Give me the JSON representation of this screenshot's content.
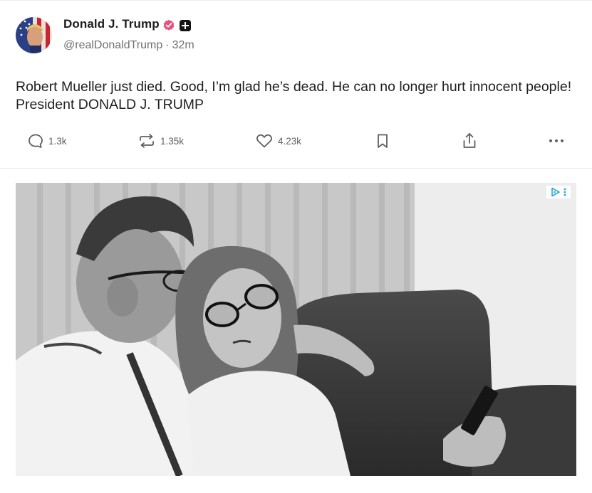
{
  "post": {
    "author_name": "Donald J. Trump",
    "handle": "@realDonaldTrump",
    "separator": "·",
    "time": "32m",
    "text": "Robert Mueller just died. Good, I’m glad he’s dead. He can no longer hurt innocent people! President DONALD J. TRUMP",
    "actions": {
      "replies": "1.3k",
      "reposts": "1.35k",
      "likes": "4.23k"
    },
    "icons": {
      "verified": "verified-badge-icon",
      "plus": "plus-badge-icon",
      "reply": "reply-icon",
      "repost": "repost-icon",
      "like": "heart-icon",
      "bookmark": "bookmark-icon",
      "share": "share-icon",
      "more": "more-icon"
    }
  },
  "ad": {
    "icons": [
      "ad-choices-icon",
      "ad-menu-icon"
    ]
  },
  "colors": {
    "verified": "#e8507a",
    "ad_choices": "#2aa7d8",
    "icon": "#5f5f5f"
  }
}
